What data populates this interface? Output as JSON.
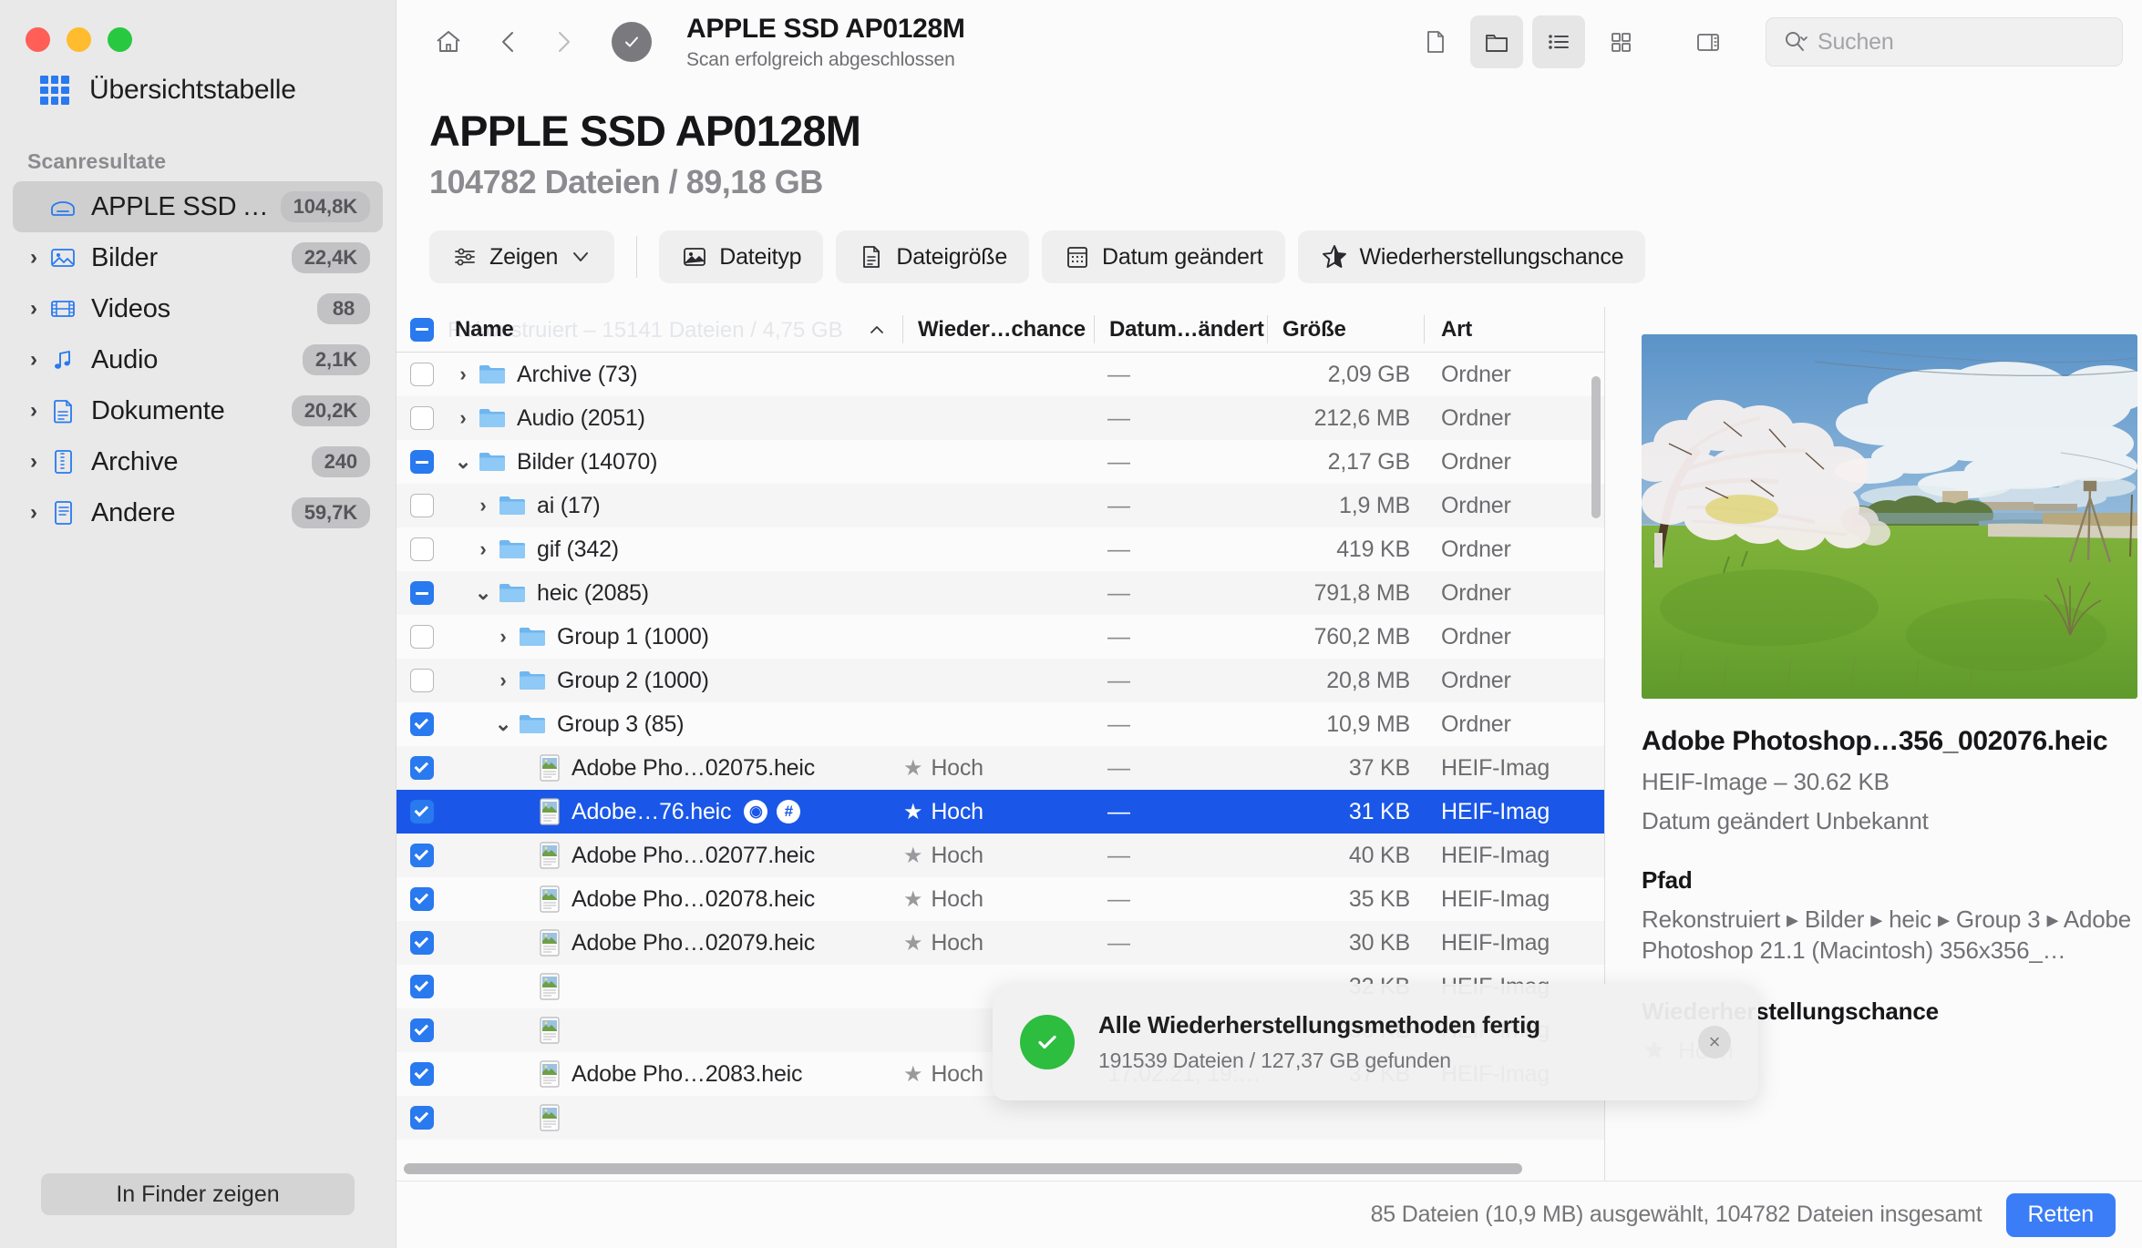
{
  "window": {
    "traffic_lights": [
      "close",
      "minimize",
      "zoom"
    ]
  },
  "sidebar": {
    "overview_label": "Übersichtstabelle",
    "section_title": "Scanresultate",
    "items": [
      {
        "label": "APPLE SSD AP…",
        "badge": "104,8K",
        "icon": "disk-icon",
        "expandable": false,
        "selected": true
      },
      {
        "label": "Bilder",
        "badge": "22,4K",
        "icon": "image-icon",
        "expandable": true,
        "selected": false
      },
      {
        "label": "Videos",
        "badge": "88",
        "icon": "film-icon",
        "expandable": true,
        "selected": false
      },
      {
        "label": "Audio",
        "badge": "2,1K",
        "icon": "music-icon",
        "expandable": true,
        "selected": false
      },
      {
        "label": "Dokumente",
        "badge": "20,2K",
        "icon": "document-icon",
        "expandable": true,
        "selected": false
      },
      {
        "label": "Archive",
        "badge": "240",
        "icon": "archive-icon",
        "expandable": true,
        "selected": false
      },
      {
        "label": "Andere",
        "badge": "59,7K",
        "icon": "other-file-icon",
        "expandable": true,
        "selected": false
      }
    ],
    "finder_button": "In Finder zeigen"
  },
  "toolbar": {
    "home_icon": "home-icon",
    "back_icon": "chevron-left-icon",
    "forward_icon": "chevron-right-icon",
    "status_icon": "check-circle-icon",
    "title": "APPLE SSD AP0128M",
    "subtitle": "Scan erfolgreich abgeschlossen",
    "right_icons": [
      "file-view-icon",
      "folder-view-icon",
      "list-view-icon",
      "grid-view-icon",
      "sidebar-toggle-icon"
    ],
    "search_placeholder": "Suchen",
    "search_value": ""
  },
  "page": {
    "title": "APPLE SSD AP0128M",
    "subtitle": "104782 Dateien / 89,18 GB"
  },
  "filters": [
    {
      "label": "Zeigen",
      "icon": "sliders-icon",
      "caret": true
    },
    {
      "label": "Dateityp",
      "icon": "image-filter-icon",
      "caret": false
    },
    {
      "label": "Dateigröße",
      "icon": "document-filter-icon",
      "caret": false
    },
    {
      "label": "Datum geändert",
      "icon": "calendar-icon",
      "caret": false
    },
    {
      "label": "Wiederherstellungschance",
      "icon": "star-icon",
      "caret": false
    }
  ],
  "table": {
    "ghost_text": "Rekonstruiert – 15141 Dateien / 4,75 GB",
    "headers": {
      "name": "Name",
      "sort_icon": "chevron-up-icon",
      "chance": "Wieder…chance",
      "date": "Datum…ändert",
      "size": "Größe",
      "art": "Art"
    },
    "header_checkbox": "mixed",
    "rows": [
      {
        "check": "unchecked",
        "twisty": "collapsed",
        "indent": 0,
        "icon": "folder-icon",
        "name": "Archive (73)",
        "chance": "",
        "date": "—",
        "size": "2,09 GB",
        "art": "Ordner",
        "selected": false,
        "alt": false
      },
      {
        "check": "unchecked",
        "twisty": "collapsed",
        "indent": 0,
        "icon": "folder-icon",
        "name": "Audio (2051)",
        "chance": "",
        "date": "—",
        "size": "212,6 MB",
        "art": "Ordner",
        "selected": false,
        "alt": true
      },
      {
        "check": "mixed",
        "twisty": "expanded",
        "indent": 0,
        "icon": "folder-icon",
        "name": "Bilder (14070)",
        "chance": "",
        "date": "—",
        "size": "2,17 GB",
        "art": "Ordner",
        "selected": false,
        "alt": false
      },
      {
        "check": "unchecked",
        "twisty": "collapsed",
        "indent": 1,
        "icon": "folder-icon",
        "name": "ai (17)",
        "chance": "",
        "date": "—",
        "size": "1,9 MB",
        "art": "Ordner",
        "selected": false,
        "alt": true
      },
      {
        "check": "unchecked",
        "twisty": "collapsed",
        "indent": 1,
        "icon": "folder-icon",
        "name": "gif (342)",
        "chance": "",
        "date": "—",
        "size": "419 KB",
        "art": "Ordner",
        "selected": false,
        "alt": false
      },
      {
        "check": "mixed",
        "twisty": "expanded",
        "indent": 1,
        "icon": "folder-icon",
        "name": "heic (2085)",
        "chance": "",
        "date": "—",
        "size": "791,8 MB",
        "art": "Ordner",
        "selected": false,
        "alt": true
      },
      {
        "check": "unchecked",
        "twisty": "collapsed",
        "indent": 2,
        "icon": "folder-icon",
        "name": "Group 1 (1000)",
        "chance": "",
        "date": "—",
        "size": "760,2 MB",
        "art": "Ordner",
        "selected": false,
        "alt": false
      },
      {
        "check": "unchecked",
        "twisty": "collapsed",
        "indent": 2,
        "icon": "folder-icon",
        "name": "Group 2 (1000)",
        "chance": "",
        "date": "—",
        "size": "20,8 MB",
        "art": "Ordner",
        "selected": false,
        "alt": true
      },
      {
        "check": "checked",
        "twisty": "expanded",
        "indent": 2,
        "icon": "folder-icon",
        "name": "Group 3 (85)",
        "chance": "",
        "date": "—",
        "size": "10,9 MB",
        "art": "Ordner",
        "selected": false,
        "alt": false
      },
      {
        "check": "checked",
        "twisty": "none",
        "indent": 3,
        "icon": "heic-file-icon",
        "name": "Adobe Pho…02075.heic",
        "chance": "Hoch",
        "date": "—",
        "size": "37 KB",
        "art": "HEIF-Imag",
        "selected": false,
        "alt": true
      },
      {
        "check": "checked",
        "twisty": "none",
        "indent": 3,
        "icon": "heic-file-icon",
        "name": "Adobe…76.heic",
        "chance": "Hoch",
        "date": "—",
        "size": "31 KB",
        "art": "HEIF-Imag",
        "selected": true,
        "alt": false,
        "row_icons": [
          "preview-eye-icon",
          "hash-icon"
        ]
      },
      {
        "check": "checked",
        "twisty": "none",
        "indent": 3,
        "icon": "heic-file-icon",
        "name": "Adobe Pho…02077.heic",
        "chance": "Hoch",
        "date": "—",
        "size": "40 KB",
        "art": "HEIF-Imag",
        "selected": false,
        "alt": true
      },
      {
        "check": "checked",
        "twisty": "none",
        "indent": 3,
        "icon": "heic-file-icon",
        "name": "Adobe Pho…02078.heic",
        "chance": "Hoch",
        "date": "—",
        "size": "35 KB",
        "art": "HEIF-Imag",
        "selected": false,
        "alt": false
      },
      {
        "check": "checked",
        "twisty": "none",
        "indent": 3,
        "icon": "heic-file-icon",
        "name": "Adobe Pho…02079.heic",
        "chance": "Hoch",
        "date": "—",
        "size": "30 KB",
        "art": "HEIF-Imag",
        "selected": false,
        "alt": true
      },
      {
        "check": "checked",
        "twisty": "none",
        "indent": 3,
        "icon": "heic-file-icon",
        "name": "",
        "chance": "",
        "date": "",
        "size": "32 KB",
        "art": "HEIF-Imag",
        "selected": false,
        "alt": false
      },
      {
        "check": "checked",
        "twisty": "none",
        "indent": 3,
        "icon": "heic-file-icon",
        "name": "",
        "chance": "",
        "date": "",
        "size": "36 KB",
        "art": "HEIF-Imag",
        "selected": false,
        "alt": true
      },
      {
        "check": "checked",
        "twisty": "none",
        "indent": 3,
        "icon": "heic-file-icon",
        "name": "Adobe Pho…2083.heic",
        "chance": "Hoch",
        "date": "17.02.21, 19:…",
        "size": "37 KB",
        "art": "HEIF-Imag",
        "selected": false,
        "alt": false
      },
      {
        "check": "checked",
        "twisty": "none",
        "indent": 3,
        "icon": "heic-file-icon",
        "name": "",
        "chance": "",
        "date": "",
        "size": "",
        "art": "",
        "selected": false,
        "alt": true
      }
    ]
  },
  "detail": {
    "preview_alt": "blossoming-tree-meadow-photo",
    "file_name": "Adobe Photoshop…356_002076.heic",
    "file_meta": "HEIF-Image – 30.62 KB",
    "date_label": "Datum geändert",
    "date_value": "Unbekannt",
    "path_heading": "Pfad",
    "path_value": "Rekonstruiert ▸ Bilder ▸ heic ▸ Group 3 ▸ Adobe Photoshop 21.1 (Macintosh) 356x356_…",
    "chance_heading": "Wiederherstellungschance",
    "chance_value": "Hoch"
  },
  "toast": {
    "title": "Alle Wiederherstellungsmethoden fertig",
    "subtitle": "191539 Dateien / 127,37 GB gefunden",
    "close_label": "×",
    "icon": "success-check-icon"
  },
  "statusbar": {
    "text": "85 Dateien (10,9 MB) ausgewählt, 104782 Dateien insgesamt",
    "save_label": "Retten"
  },
  "colors": {
    "accent": "#2979ef",
    "selection": "#1a57e8",
    "save_button": "#3b7df6",
    "success": "#2dbd3f"
  }
}
